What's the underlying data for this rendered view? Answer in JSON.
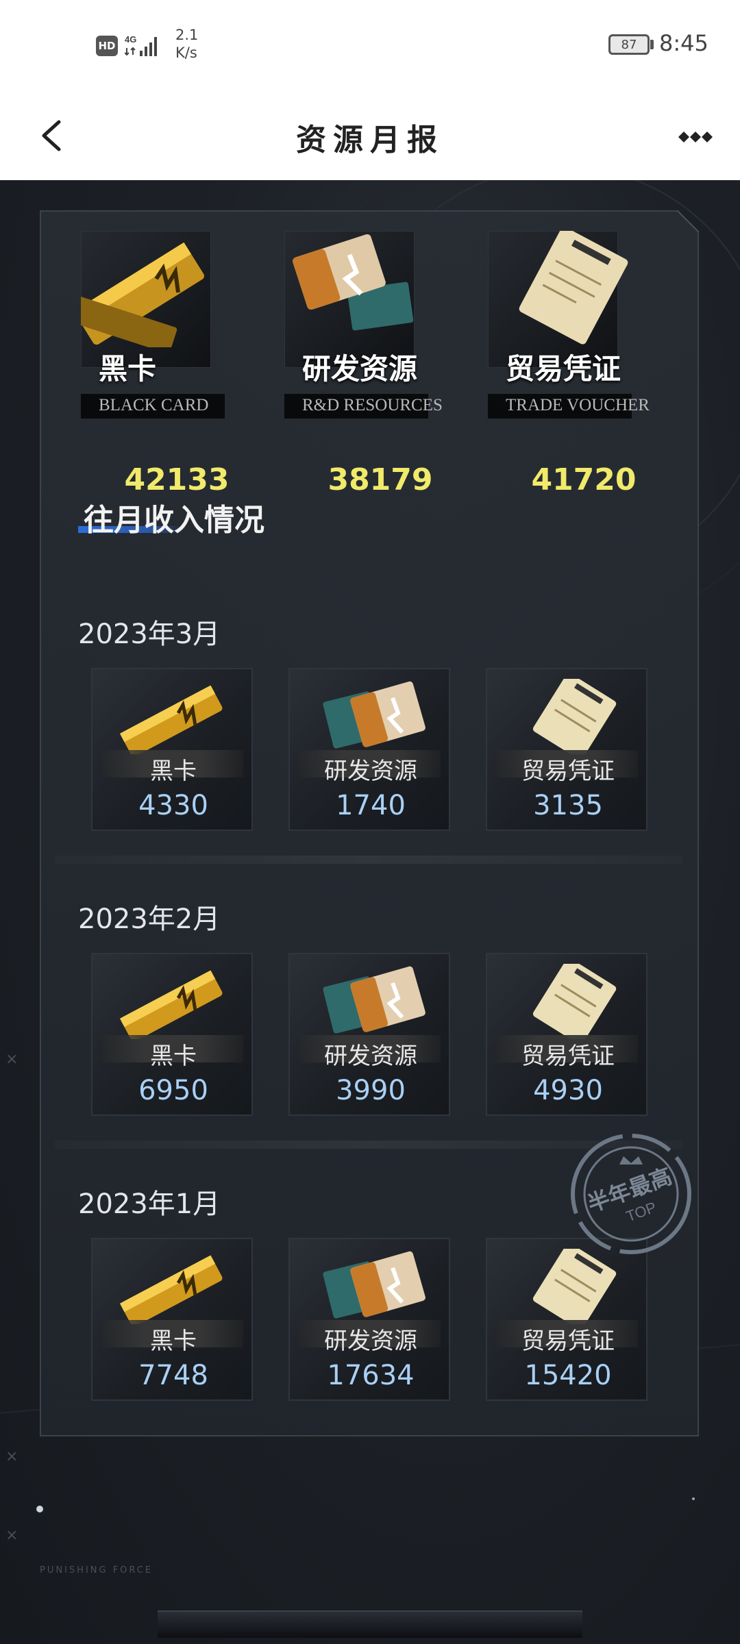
{
  "status_bar": {
    "hd": "HD",
    "network": "4G",
    "speed_value": "2.1",
    "speed_unit": "K/s",
    "battery": "87",
    "time": "8:45"
  },
  "header": {
    "title": "资源月报",
    "back_icon": "chevron-left-icon",
    "more_icon": "more-dots-icon"
  },
  "totals": [
    {
      "name": "黑卡",
      "en": "BLACK CARD",
      "value": "42133"
    },
    {
      "name": "研发资源",
      "en": "R&D RESOURCES",
      "value": "38179"
    },
    {
      "name": "贸易凭证",
      "en": "TRADE VOUCHER",
      "value": "41720"
    }
  ],
  "section_title": "往月收入情况",
  "months": [
    {
      "label": "2023年3月",
      "items": [
        {
          "name": "黑卡",
          "value": "4330"
        },
        {
          "name": "研发资源",
          "value": "1740"
        },
        {
          "name": "贸易凭证",
          "value": "3135"
        }
      ]
    },
    {
      "label": "2023年2月",
      "items": [
        {
          "name": "黑卡",
          "value": "6950"
        },
        {
          "name": "研发资源",
          "value": "3990"
        },
        {
          "name": "贸易凭证",
          "value": "4930"
        }
      ]
    },
    {
      "label": "2023年1月",
      "items": [
        {
          "name": "黑卡",
          "value": "7748"
        },
        {
          "name": "研发资源",
          "value": "17634"
        },
        {
          "name": "贸易凭证",
          "value": "15420"
        }
      ]
    }
  ],
  "stamp": {
    "text": "半年最高",
    "sub": "TOP"
  },
  "footer": {
    "brand": "PUNISHING FORCE"
  },
  "colors": {
    "accent_total": "#f1ea6a",
    "accent_value": "#a9d0f5",
    "underline": "#2d6dd7"
  }
}
